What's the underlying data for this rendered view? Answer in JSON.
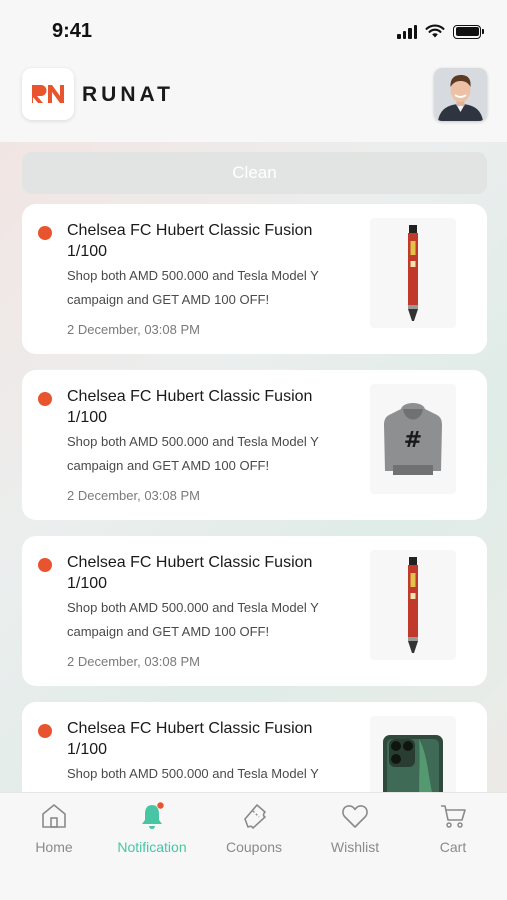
{
  "status_bar": {
    "time": "9:41",
    "icons": [
      "signal-icon",
      "wifi-icon",
      "battery-icon"
    ]
  },
  "header": {
    "logo_mark": "RN",
    "brand": "RUNAT",
    "avatar_icon": "user-avatar"
  },
  "clean_button": {
    "label": "Clean"
  },
  "notifications": [
    {
      "title": "Chelsea FC Hubert Classic Fusion 1/100",
      "body": "Shop both AMD 500.000 and Tesla Model Y campaign and GET AMD 100 OFF!",
      "date": "2 December, 03:08 PM",
      "image": "pen-image"
    },
    {
      "title": "Chelsea FC Hubert Classic Fusion 1/100",
      "body": "Shop both AMD 500.000 and Tesla Model Y campaign and GET AMD 100 OFF!",
      "date": "2 December, 03:08 PM",
      "image": "hoodie-image"
    },
    {
      "title": "Chelsea FC Hubert Classic Fusion 1/100",
      "body": "Shop both AMD 500.000 and Tesla Model Y campaign and GET AMD 100 OFF!",
      "date": "2 December, 03:08 PM",
      "image": "pen-image"
    },
    {
      "title": "Chelsea FC Hubert Classic Fusion 1/100",
      "body": "Shop both AMD 500.000 and Tesla Model Y",
      "date": "",
      "image": "phone-image"
    }
  ],
  "tabs": [
    {
      "label": "Home",
      "icon": "home-icon",
      "active": false
    },
    {
      "label": "Notification",
      "icon": "bell-icon",
      "active": true
    },
    {
      "label": "Coupons",
      "icon": "coupon-icon",
      "active": false
    },
    {
      "label": "Wishlist",
      "icon": "heart-icon",
      "active": false
    },
    {
      "label": "Cart",
      "icon": "cart-icon",
      "active": false
    }
  ],
  "colors": {
    "accent": "#48c6a3",
    "unread_dot": "#e8542d",
    "brand_orange": "#e8542d"
  }
}
